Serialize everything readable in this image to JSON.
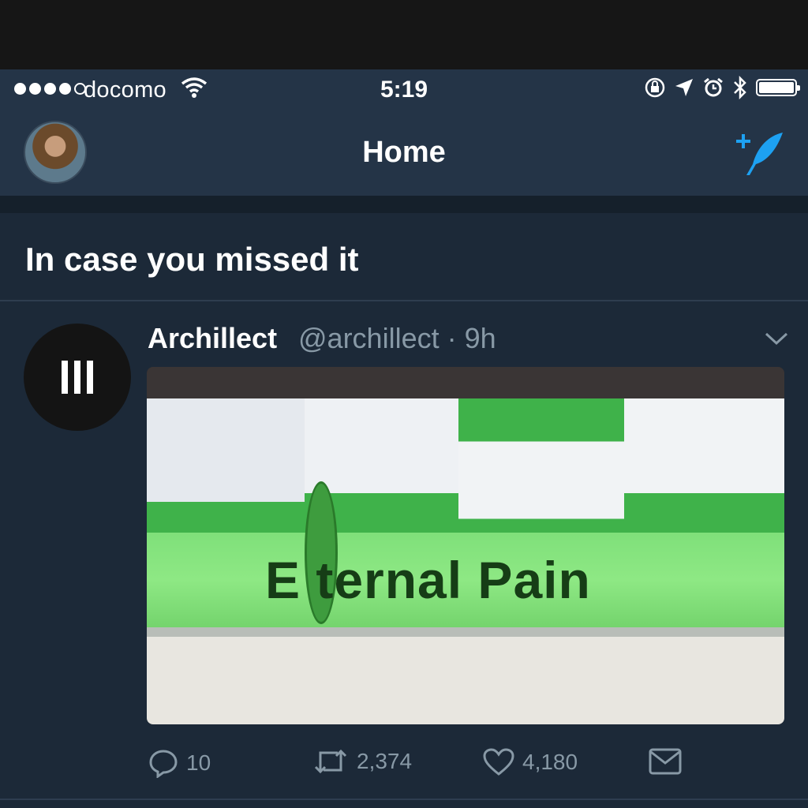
{
  "status_bar": {
    "carrier": "docomo",
    "time": "5:19",
    "signal_dots_filled": 4,
    "signal_dots_total": 5
  },
  "nav": {
    "title": "Home",
    "compose_icon": "compose-tweet-icon",
    "avatar_icon": "profile-avatar"
  },
  "section": {
    "title": "In case you missed it"
  },
  "tweet": {
    "display_name": "Archillect",
    "handle": "@archillect",
    "time": "· 9h",
    "media_sign_text": "E ternal Pain",
    "actions": {
      "replies": "10",
      "retweets": "2,374",
      "likes": "4,180"
    }
  },
  "colors": {
    "accent": "#1da1f2",
    "background": "#1c2938",
    "bar": "#243447",
    "muted": "#8899a6"
  }
}
